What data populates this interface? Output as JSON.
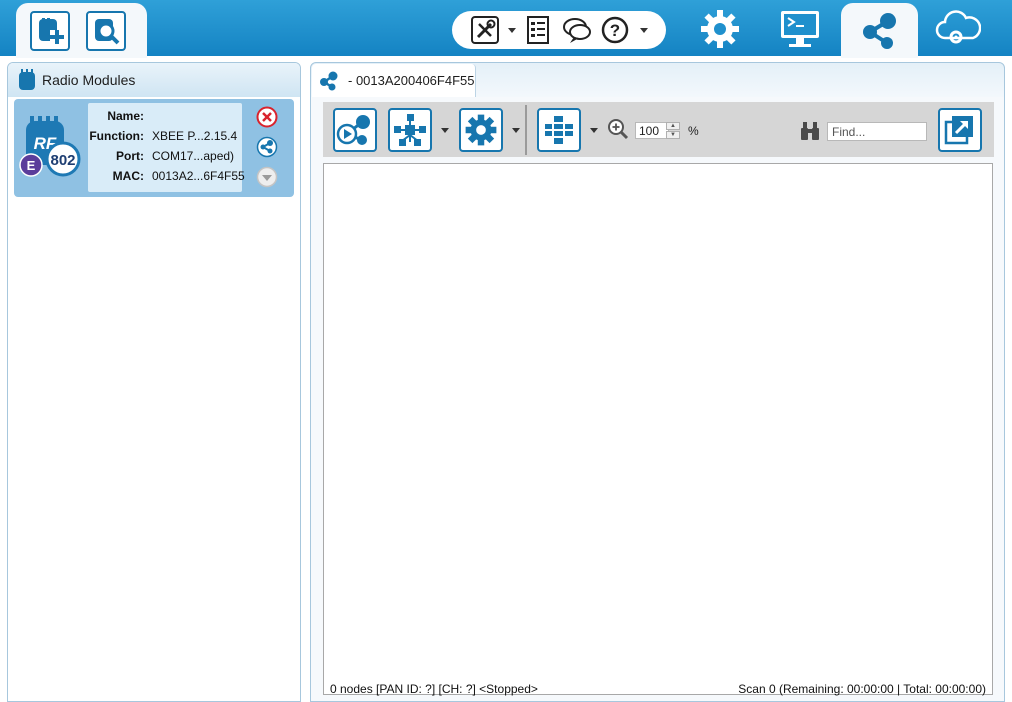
{
  "toolbar_top": {
    "left_buttons": [
      {
        "icon": "add-device-icon"
      },
      {
        "icon": "discover-devices-icon"
      }
    ],
    "tools": [
      {
        "icon": "tools-icon",
        "has_dropdown": true
      },
      {
        "icon": "xctu-profile-icon",
        "has_dropdown": false
      },
      {
        "icon": "feedback-icon",
        "has_dropdown": false
      },
      {
        "icon": "help-icon",
        "has_dropdown": true
      }
    ],
    "modes": [
      {
        "icon": "configuration-mode-icon",
        "active": false
      },
      {
        "icon": "consoles-mode-icon",
        "active": false
      },
      {
        "icon": "network-mode-icon",
        "active": true
      },
      {
        "icon": "cloud-mode-icon",
        "active": false
      }
    ]
  },
  "left_panel": {
    "title": "Radio Modules",
    "modules": [
      {
        "badge_top": "RF",
        "badge_bottom": "802",
        "badge_letter": "E",
        "fields": [
          {
            "label": "Name:",
            "value": ""
          },
          {
            "label": "Function:",
            "value": "XBEE P...2.15.4"
          },
          {
            "label": "Port:",
            "value": "COM17...aped)"
          },
          {
            "label": "MAC:",
            "value": "0013A2...6F4F55"
          }
        ]
      }
    ]
  },
  "network_tab": {
    "label": "- 0013A200406F4F55"
  },
  "network_toolbar": {
    "zoom_value": "100",
    "zoom_unit": "%",
    "find_placeholder": "Find..."
  },
  "status": {
    "left": "0 nodes [PAN ID: ?] [CH: ?]  <Stopped>",
    "right": "Scan 0 (Remaining: 00:00:00 | Total: 00:00:00)"
  },
  "colors": {
    "accent": "#1776ae",
    "topbar": "#1f90cd",
    "card": "#8fc1e3",
    "remove": "#d9232d",
    "badge_letter": "#5b3d9b"
  }
}
